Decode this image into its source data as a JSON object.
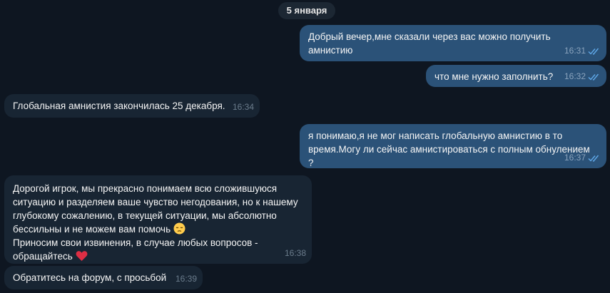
{
  "date_label": "5 января",
  "messages": [
    {
      "id": "m1",
      "text": "Добрый вечер,мне сказали через вас можно получить\nамнистию",
      "time": "16:31"
    },
    {
      "id": "m2",
      "text": "что мне нужно заполнить?",
      "time": "16:32"
    },
    {
      "id": "m3",
      "text": "Глобальная амнистия закончилась 25 декабря.",
      "time": "16:34"
    },
    {
      "id": "m4",
      "text": "я понимаю,я не мог написать глобальную амнистию в то\nвремя.Могу ли сейчас амнистироваться с полным обнулением ?",
      "time": "16:37"
    },
    {
      "id": "m5",
      "text_main": "Дорогой игрок, мы прекрасно понимаем всю сложившуюся\nситуацию и разделяем ваше чувство негодования, но к нашему\nглубокому сожалению, в текущей ситуации, мы абсолютно\nбессильны и не можем вам помочь ",
      "text_tail": "Приносим свои извинения, в случае любых вопросов -\nобращайтесь ",
      "time": "16:38"
    },
    {
      "id": "m6",
      "text": "Обратитесь на форум, с просьбой",
      "time": "16:39"
    }
  ],
  "colors": {
    "background": "#0e1621",
    "outgoing_bubble": "#2b5278",
    "incoming_bubble": "#182533",
    "read_ticks": "#5fa8e8"
  },
  "icons": [
    "double-check-icon",
    "pensive-face-emoji",
    "red-heart-emoji"
  ]
}
